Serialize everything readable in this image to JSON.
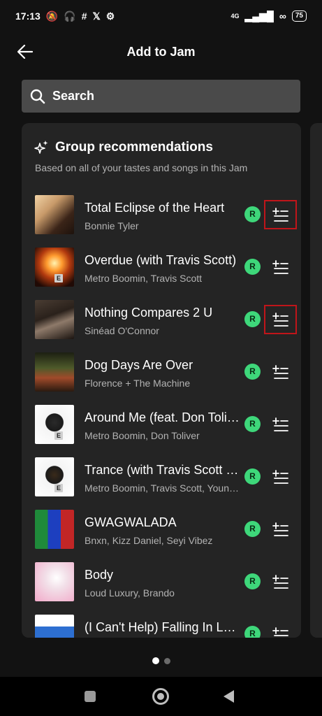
{
  "status": {
    "time": "17:13",
    "network": "4G",
    "battery": "75"
  },
  "header": {
    "title": "Add to Jam"
  },
  "search": {
    "label": "Search"
  },
  "section": {
    "title": "Group recommendations",
    "subtitle": "Based on all of your tastes and songs in this Jam"
  },
  "tracks": [
    {
      "title": "Total Eclipse of the Heart",
      "artist": "Bonnie Tyler",
      "avatar": "R"
    },
    {
      "title": "Overdue (with Travis Scott)",
      "artist": "Metro Boomin, Travis Scott",
      "avatar": "R",
      "explicit": "E"
    },
    {
      "title": "Nothing Compares 2 U",
      "artist": "Sinéad O'Connor",
      "avatar": "R"
    },
    {
      "title": "Dog Days Are Over",
      "artist": "Florence + The Machine",
      "avatar": "R"
    },
    {
      "title": "Around Me (feat. Don Toliver)",
      "artist": "Metro Boomin, Don Toliver",
      "avatar": "R",
      "explicit": "E"
    },
    {
      "title": "Trance (with Travis Scott & Young Thug)",
      "artist": "Metro Boomin, Travis Scott, Young Thug",
      "avatar": "R",
      "explicit": "E"
    },
    {
      "title": "GWAGWALADA",
      "artist": "Bnxn, Kizz Daniel, Seyi Vibez",
      "avatar": "R"
    },
    {
      "title": "Body",
      "artist": "Loud Luxury, Brando",
      "avatar": "R"
    },
    {
      "title": "(I Can't Help) Falling In Love With You",
      "artist": "",
      "avatar": "R"
    }
  ],
  "colors": {
    "background": "#121212",
    "card": "#242424",
    "avatar": "#3ed77a",
    "highlight": "#c0151a"
  }
}
